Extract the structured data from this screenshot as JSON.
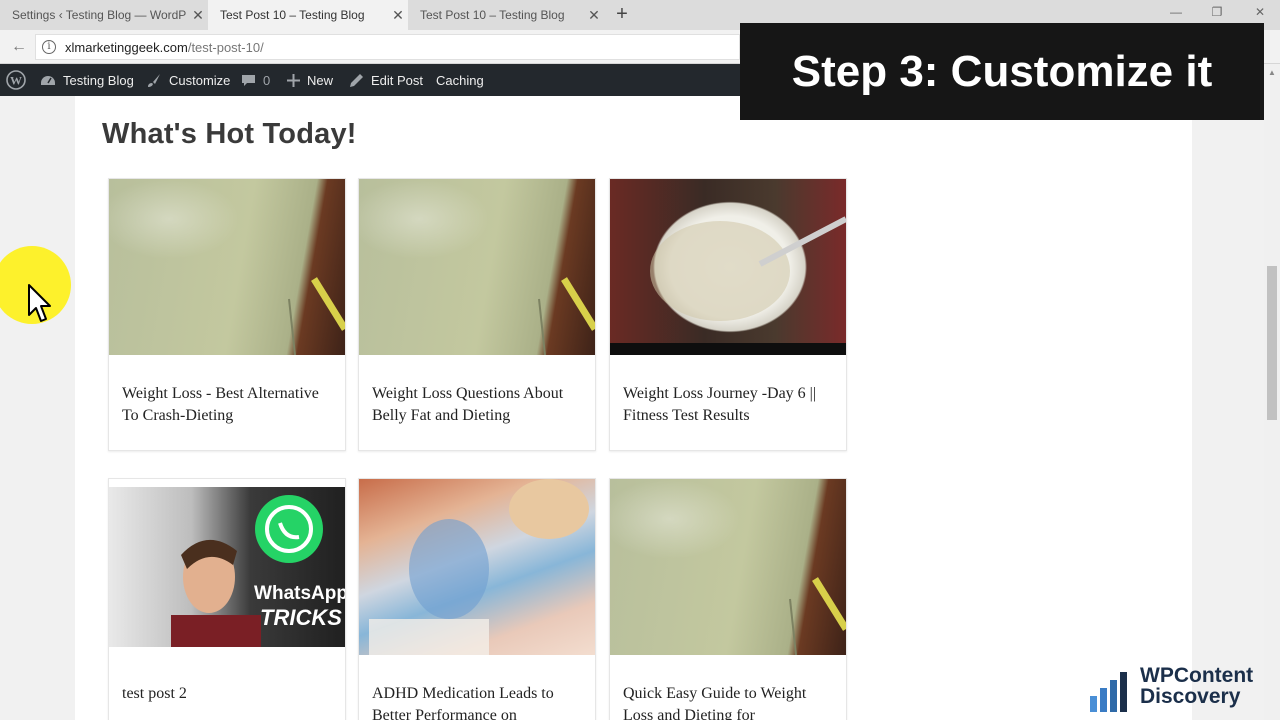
{
  "browser": {
    "tabs": [
      {
        "label": "Settings ‹ Testing Blog — WordP",
        "close": "✕"
      },
      {
        "label": "Test Post 10 – Testing Blog",
        "close": "✕"
      },
      {
        "label": "Test Post 10 – Testing Blog",
        "close": "✕"
      }
    ],
    "new_tab": "+",
    "window_controls": {
      "minimize": "—",
      "restore": "❐",
      "close": "✕"
    },
    "back": "←",
    "info": "i",
    "url_host": "xlmarketinggeek.com",
    "url_path": "/test-post-10/"
  },
  "adminbar": {
    "site_name": "Testing Blog",
    "customize": "Customize",
    "comments_count": "0",
    "new": "New",
    "edit_post": "Edit Post",
    "caching": "Caching",
    "icons": [
      "wordpress-logo-icon",
      "dashboard-icon",
      "brush-icon",
      "comment-icon",
      "plus-icon",
      "pencil-icon"
    ]
  },
  "section": {
    "title": "What's Hot Today!"
  },
  "posts": [
    {
      "title": "Weight Loss - Best Alternative To Crash-Dieting",
      "image": "bottle"
    },
    {
      "title": "Weight Loss Questions About Belly Fat and Dieting",
      "image": "bottle"
    },
    {
      "title": "Weight Loss Journey -Day 6 || Fitness Test Results",
      "image": "bowl"
    },
    {
      "title": "test post 2",
      "image": "whatsapp"
    },
    {
      "title": "ADHD Medication Leads to Better Performance on",
      "image": "study"
    },
    {
      "title": "Quick Easy Guide to Weight Loss and Dieting for",
      "image": "bottle"
    }
  ],
  "image_text": {
    "whatsapp_1": "WhatsApp",
    "whatsapp_2": "TRICKS"
  },
  "overlay": {
    "step": "Step 3: Customize it"
  },
  "logo": {
    "line1": "WPContent",
    "line2": "Discovery"
  },
  "colors": {
    "adminbar": "#23282d",
    "overlay": "#161616",
    "cursor_halo": "#fff000",
    "whatsapp": "#25d366",
    "logo": "#1b2f4a"
  }
}
